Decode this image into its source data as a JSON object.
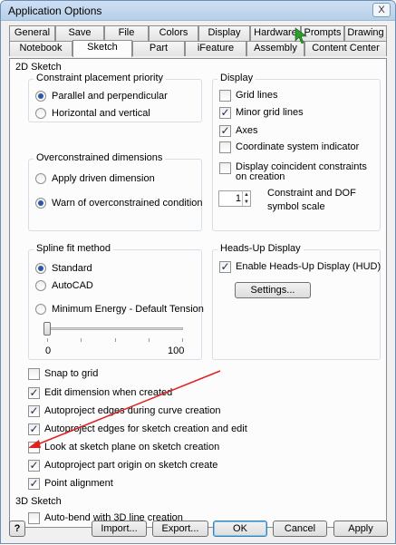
{
  "window": {
    "title": "Application Options",
    "close_glyph": "X"
  },
  "tabs_top": [
    "General",
    "Save",
    "File",
    "Colors",
    "Display",
    "Hardware",
    "Prompts",
    "Drawing"
  ],
  "tabs_bottom": [
    "Notebook",
    "Sketch",
    "Part",
    "iFeature",
    "Assembly",
    "Content Center"
  ],
  "active_tab": "Sketch",
  "sketch2d": {
    "section_label": "2D Sketch",
    "constraint_priority": {
      "title": "Constraint placement priority",
      "options": [
        "Parallel and perpendicular",
        "Horizontal and vertical"
      ],
      "selected": 0
    },
    "overconstrained": {
      "title": "Overconstrained dimensions",
      "options": [
        "Apply driven dimension",
        "Warn of overconstrained condition"
      ],
      "selected": 1
    },
    "display": {
      "title": "Display",
      "items": [
        {
          "label": "Grid lines",
          "checked": false
        },
        {
          "label": "Minor grid lines",
          "checked": true
        },
        {
          "label": "Axes",
          "checked": true
        },
        {
          "label": "Coordinate system indicator",
          "checked": false
        },
        {
          "label": "Display coincident constraints on creation",
          "checked": false
        }
      ],
      "spin_value": "1",
      "spin_label": "Constraint and DOF symbol scale"
    },
    "spline": {
      "title": "Spline fit method",
      "options": [
        "Standard",
        "AutoCAD",
        "Minimum Energy - Default Tension"
      ],
      "selected": 0,
      "slider_min": "0",
      "slider_max": "100",
      "slider_value": 0
    },
    "hud": {
      "title": "Heads-Up Display",
      "enable_label": "Enable Heads-Up Display (HUD)",
      "enabled": true,
      "settings_label": "Settings..."
    },
    "options": [
      {
        "label": "Snap to grid",
        "checked": false
      },
      {
        "label": "Edit dimension when created",
        "checked": true
      },
      {
        "label": "Autoproject edges during curve creation",
        "checked": true
      },
      {
        "label": "Autoproject edges for sketch creation and edit",
        "checked": true
      },
      {
        "label": "Look at sketch plane on sketch creation",
        "checked": false
      },
      {
        "label": "Autoproject part origin on sketch create",
        "checked": true
      },
      {
        "label": "Point alignment",
        "checked": true
      }
    ]
  },
  "sketch3d": {
    "section_label": "3D Sketch",
    "auto_bend_label": "Auto-bend with 3D line creation",
    "auto_bend": false
  },
  "footer": {
    "help_glyph": "?",
    "import_label": "Import...",
    "export_label": "Export...",
    "ok_label": "OK",
    "cancel_label": "Cancel",
    "apply_label": "Apply"
  },
  "colors": {
    "annotation_arrow": "#e02020",
    "cursor": "#2e9e2e",
    "accent": "#2b56a8"
  }
}
